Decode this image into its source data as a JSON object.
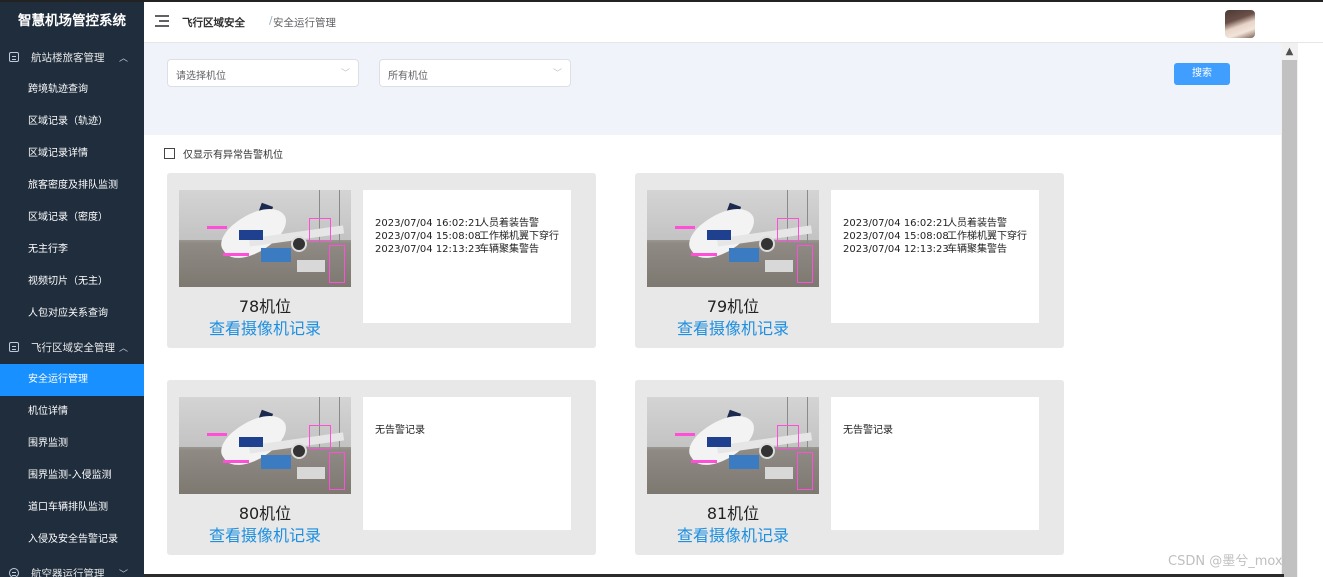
{
  "app_title": "智慧机场管控系统",
  "sidebar": {
    "groups": [
      {
        "label": "航站楼旅客管理",
        "items": [
          "跨境轨迹查询",
          "区域记录（轨迹）",
          "区域记录详情",
          "旅客密度及排队监测",
          "区域记录（密度）",
          "无主行李",
          "视频切片（无主）",
          "人包对应关系查询"
        ]
      },
      {
        "label": "飞行区域安全管理",
        "items": [
          "安全运行管理",
          "机位详情",
          "围界监测",
          "围界监测-入侵监测",
          "道口车辆排队监测",
          "入侵及安全告警记录"
        ]
      },
      {
        "label": "航空器运行管理",
        "items": []
      }
    ],
    "active_item": "安全运行管理",
    "colors": {
      "background": "#1f2d3d",
      "active": "#1890ff"
    }
  },
  "header": {
    "breadcrumb_1": "飞行区域安全",
    "breadcrumb_sep": "/",
    "breadcrumb_2": "安全运行管理"
  },
  "filters": {
    "select_1": "请选择机位",
    "select_2": "所有机位",
    "search_label": "搜索",
    "only_alarm_label": "仅显示有异常告警机位"
  },
  "cards": [
    {
      "position": "78机位",
      "link": "查看摄像机记录",
      "alarms": [
        {
          "time": "2023/07/04 16:02:21",
          "type": "人员着装告警"
        },
        {
          "time": "2023/07/04 15:08:08",
          "type": "工作梯机翼下穿行"
        },
        {
          "time": "2023/07/04 12:13:23",
          "type": "车辆聚集警告"
        }
      ],
      "no_alarm_text": ""
    },
    {
      "position": "79机位",
      "link": "查看摄像机记录",
      "alarms": [
        {
          "time": "2023/07/04 16:02:21",
          "type": "人员着装告警"
        },
        {
          "time": "2023/07/04 15:08:08",
          "type": "工作梯机翼下穿行"
        },
        {
          "time": "2023/07/04 12:13:23",
          "type": "车辆聚集警告"
        }
      ],
      "no_alarm_text": ""
    },
    {
      "position": "80机位",
      "link": "查看摄像机记录",
      "alarms": [],
      "no_alarm_text": "无告警记录"
    },
    {
      "position": "81机位",
      "link": "查看摄像机记录",
      "alarms": [],
      "no_alarm_text": "无告警记录"
    }
  ],
  "watermark": "CSDN @墨兮_moxi",
  "colors": {
    "primary": "#409eff",
    "link": "#1d8fe0",
    "filter_bg": "#f0f4fa",
    "card_bg": "#e8e8e8"
  }
}
